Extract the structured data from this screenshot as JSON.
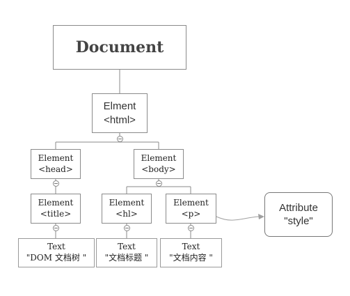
{
  "nodes": {
    "document": {
      "label": "Document"
    },
    "html": {
      "line1": "Elment",
      "line2": "<html>"
    },
    "head": {
      "line1": "Element",
      "line2": "<head>"
    },
    "body": {
      "line1": "Element",
      "line2": "<body>"
    },
    "title": {
      "line1": "Element",
      "line2": "<title>"
    },
    "h1": {
      "line1": "Element",
      "line2": "<hl>"
    },
    "p": {
      "line1": "Element",
      "line2": "<p>"
    },
    "text_dom": {
      "line1": "Text",
      "line2": "\"DOM 文档树 \""
    },
    "text_title": {
      "line1": "Text",
      "line2": "\"文档标题 \""
    },
    "text_content": {
      "line1": "Text",
      "line2": "\"文档内容 \""
    },
    "attribute": {
      "line1": "Attribute",
      "line2": "\"style\""
    }
  },
  "colors": {
    "line": "#888888",
    "border": "#8a8a8a",
    "arrow": "#a0a0a0"
  },
  "icons": {
    "collapse": "collapse-minus-icon"
  }
}
